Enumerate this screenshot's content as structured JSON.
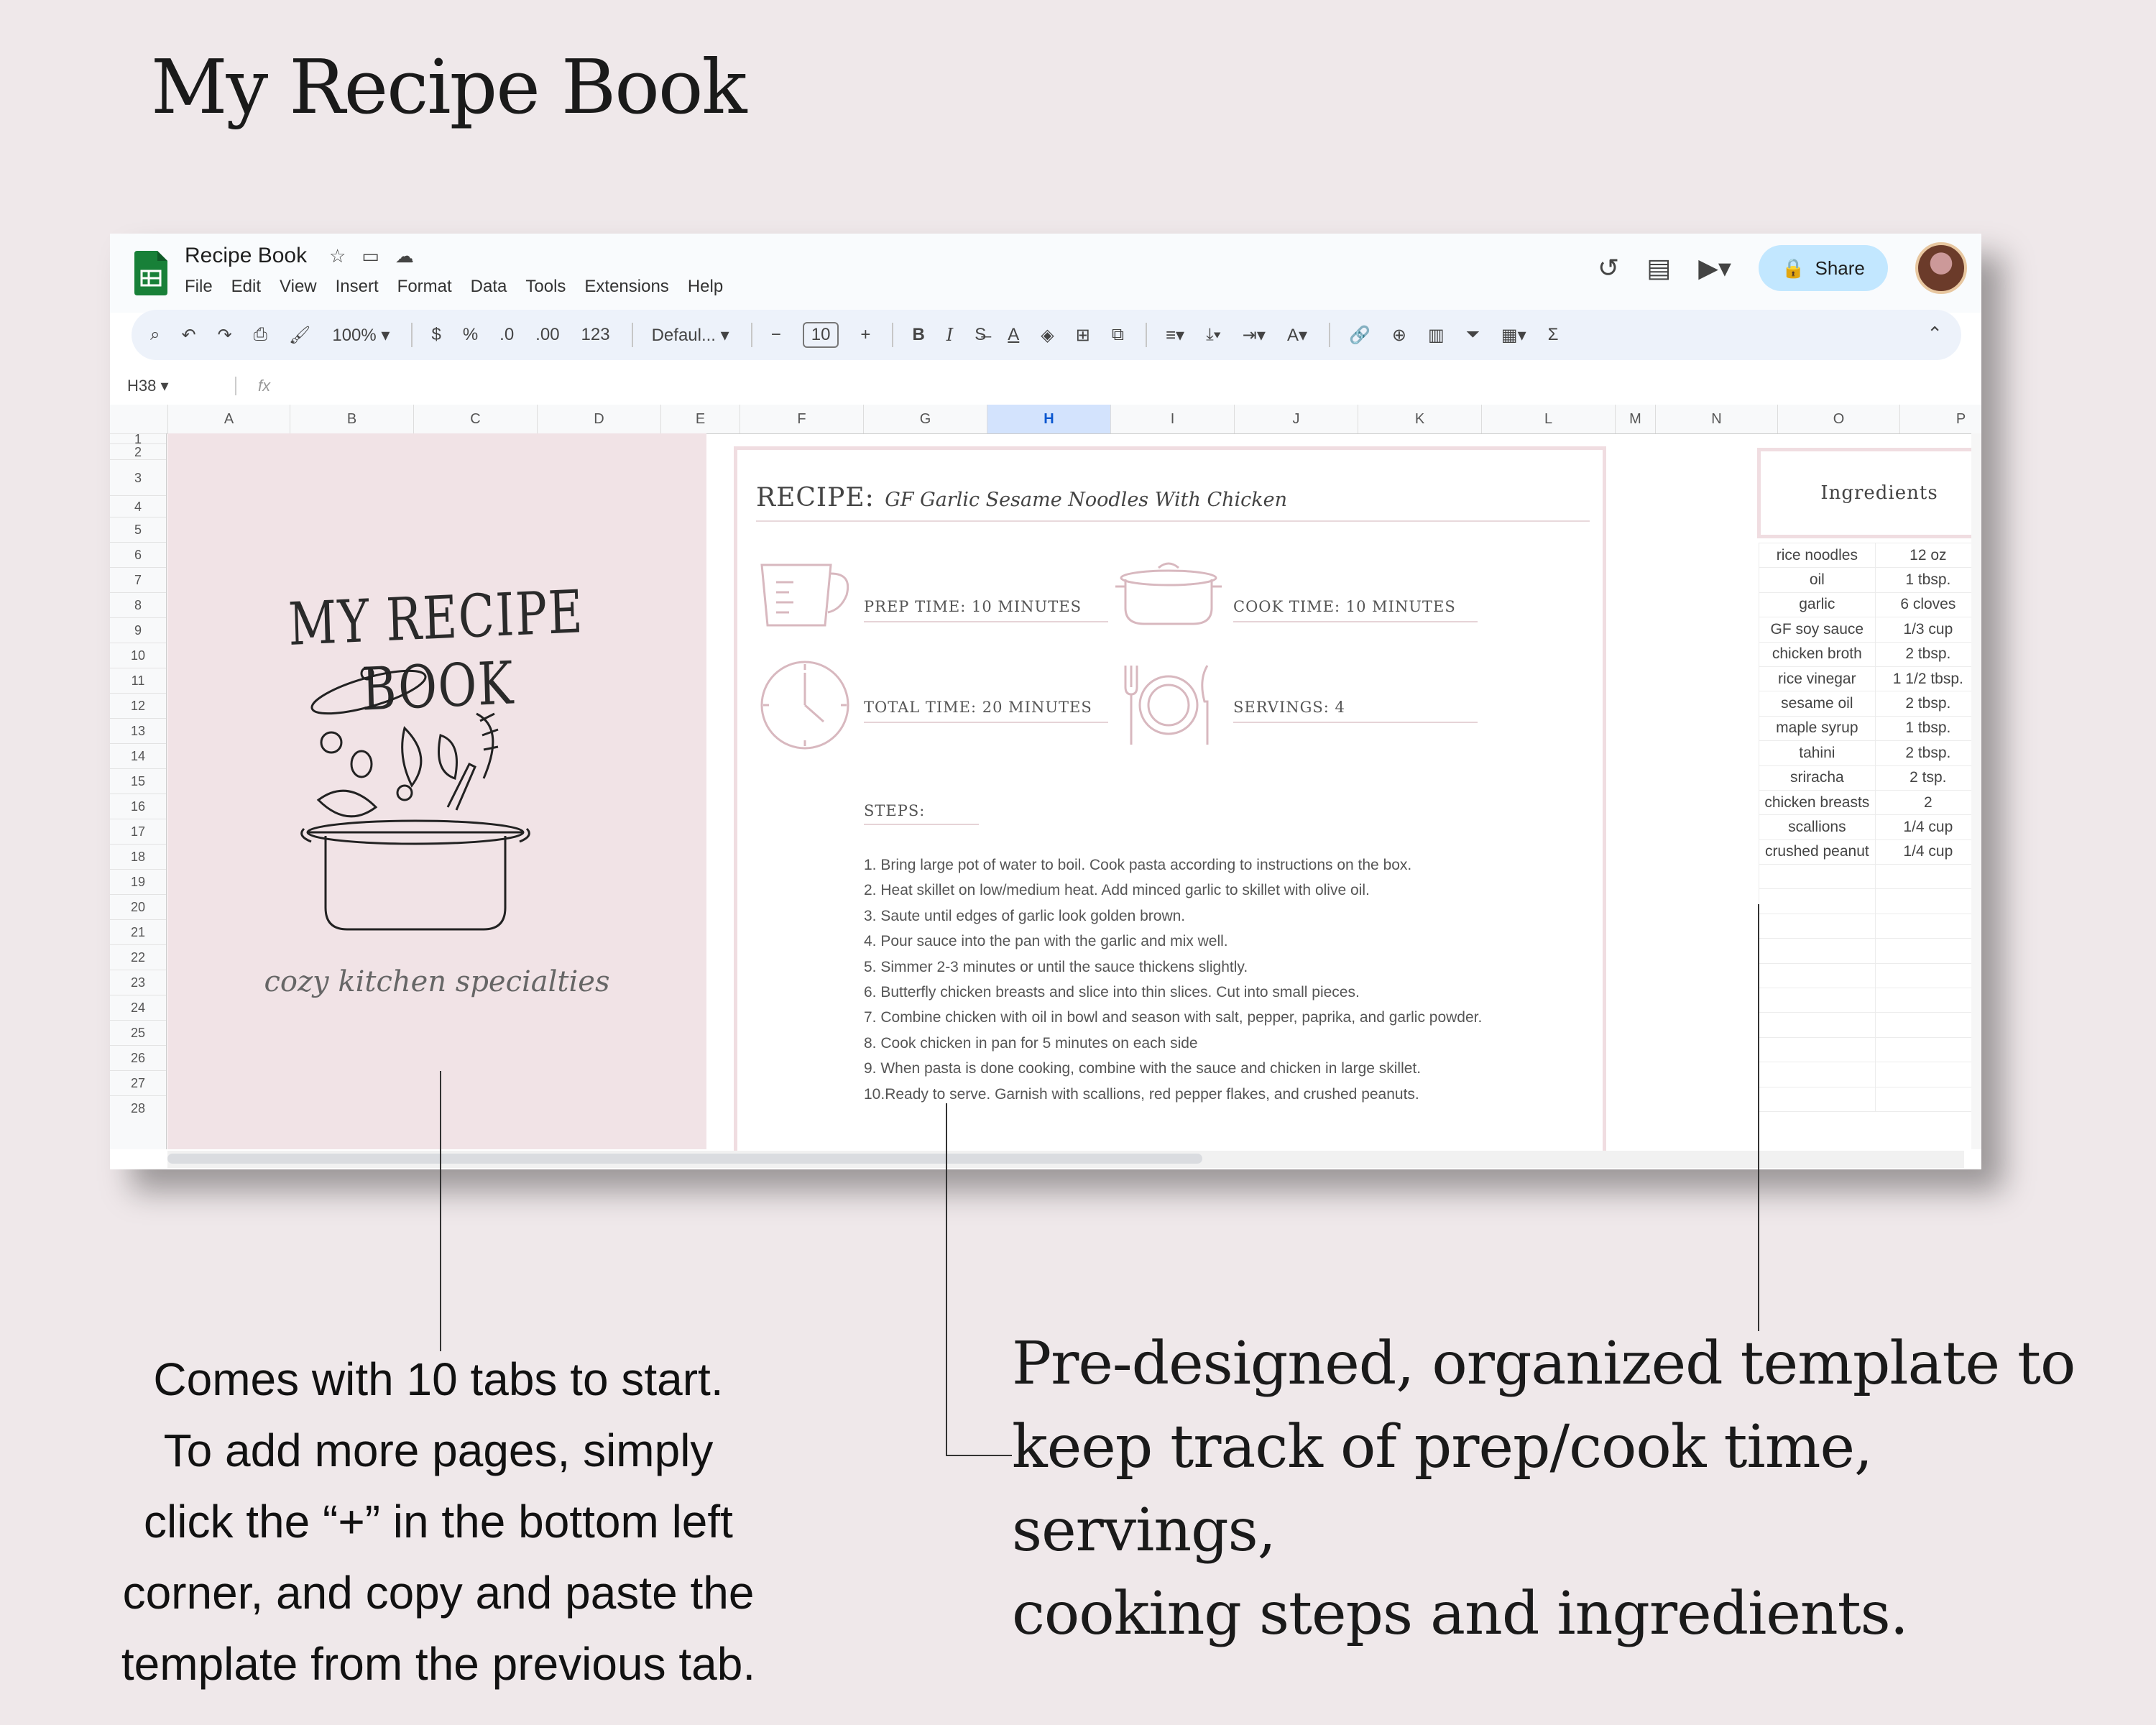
{
  "page_title": "My Recipe Book",
  "sheet": {
    "doc_title": "Recipe Book",
    "menu": [
      "File",
      "Edit",
      "View",
      "Insert",
      "Format",
      "Data",
      "Tools",
      "Extensions",
      "Help"
    ],
    "share_label": "Share",
    "toolbar": {
      "zoom": "100%",
      "currency": "$",
      "percent": "%",
      "decimal_decrease": ".0",
      "decimal_increase": ".00",
      "number_format": "123",
      "font": "Defaul...",
      "font_size": "10",
      "bold": "B",
      "italic": "I"
    },
    "name_box": "H38",
    "fx": "fx",
    "columns": [
      "A",
      "B",
      "C",
      "D",
      "E",
      "F",
      "G",
      "H",
      "I",
      "J",
      "K",
      "L",
      "M",
      "N",
      "O",
      "P"
    ],
    "active_column": "H",
    "rows": [
      "1",
      "2",
      "3",
      "4",
      "5",
      "6",
      "7",
      "8",
      "9",
      "10",
      "11",
      "12",
      "13",
      "14",
      "15",
      "16",
      "17",
      "18",
      "19",
      "20",
      "21",
      "22",
      "23",
      "24",
      "25",
      "26",
      "27",
      "28"
    ]
  },
  "cover": {
    "title": "MY RECIPE BOOK",
    "tagline": "cozy kitchen specialties"
  },
  "recipe": {
    "label": "RECIPE:",
    "name": "GF Garlic Sesame Noodles With Chicken",
    "prep": "Prep Time: 10 minutes",
    "cook": "Cook Time: 10 minutes",
    "total": "Total Time: 20 minutes",
    "servings": "Servings: 4",
    "steps_title": "Steps:",
    "steps": [
      "1. Bring large pot of water to boil. Cook pasta according to instructions on the box.",
      "2. Heat skillet on low/medium heat. Add minced garlic to skillet with olive oil.",
      "3. Saute until edges of garlic look golden brown.",
      "4. Pour sauce into the pan with the garlic and mix well.",
      "5. Simmer 2-3 minutes or until the sauce thickens slightly.",
      "6. Butterfly chicken breasts and slice into thin slices. Cut into small pieces.",
      "7. Combine chicken with oil in bowl and season with salt, pepper, paprika, and garlic powder.",
      "8. Cook chicken in pan for 5 minutes on each side",
      "9. When pasta is done cooking, combine with the sauce and chicken in large skillet.",
      "10.Ready to serve. Garnish with scallions, red pepper flakes, and crushed peanuts."
    ]
  },
  "ingredients": {
    "title": "Ingredients",
    "items": [
      {
        "name": "rice noodles",
        "qty": "12 oz"
      },
      {
        "name": "oil",
        "qty": "1 tbsp."
      },
      {
        "name": "garlic",
        "qty": "6 cloves"
      },
      {
        "name": "GF soy sauce",
        "qty": "1/3 cup"
      },
      {
        "name": "chicken broth",
        "qty": "2 tbsp."
      },
      {
        "name": "rice vinegar",
        "qty": "1 1/2 tbsp."
      },
      {
        "name": "sesame oil",
        "qty": "2 tbsp."
      },
      {
        "name": "maple syrup",
        "qty": "1 tbsp."
      },
      {
        "name": "tahini",
        "qty": "2 tbsp."
      },
      {
        "name": "sriracha",
        "qty": "2 tsp."
      },
      {
        "name": "chicken breasts",
        "qty": "2"
      },
      {
        "name": "scallions",
        "qty": "1/4 cup"
      },
      {
        "name": "crushed peanut",
        "qty": "1/4 cup"
      },
      {
        "name": "",
        "qty": ""
      },
      {
        "name": "",
        "qty": ""
      },
      {
        "name": "",
        "qty": ""
      },
      {
        "name": "",
        "qty": ""
      },
      {
        "name": "",
        "qty": ""
      },
      {
        "name": "",
        "qty": ""
      },
      {
        "name": "",
        "qty": ""
      },
      {
        "name": "",
        "qty": ""
      },
      {
        "name": "",
        "qty": ""
      },
      {
        "name": "",
        "qty": ""
      }
    ]
  },
  "callouts": {
    "left": [
      "Comes with 10 tabs to start.",
      "To add more pages, simply",
      "click the “+” in the bottom left",
      "corner, and copy and paste the",
      "template from the previous tab."
    ],
    "right": [
      "Pre-designed, organized template to",
      "keep track of prep/cook time, servings,",
      "cooking steps and ingredients."
    ]
  },
  "colors": {
    "background": "#efe8ea",
    "cover_pink": "#f1e3e6",
    "card_border": "#f0dde1",
    "share_blue": "#c2e7ff",
    "sheets_green": "#188038"
  }
}
